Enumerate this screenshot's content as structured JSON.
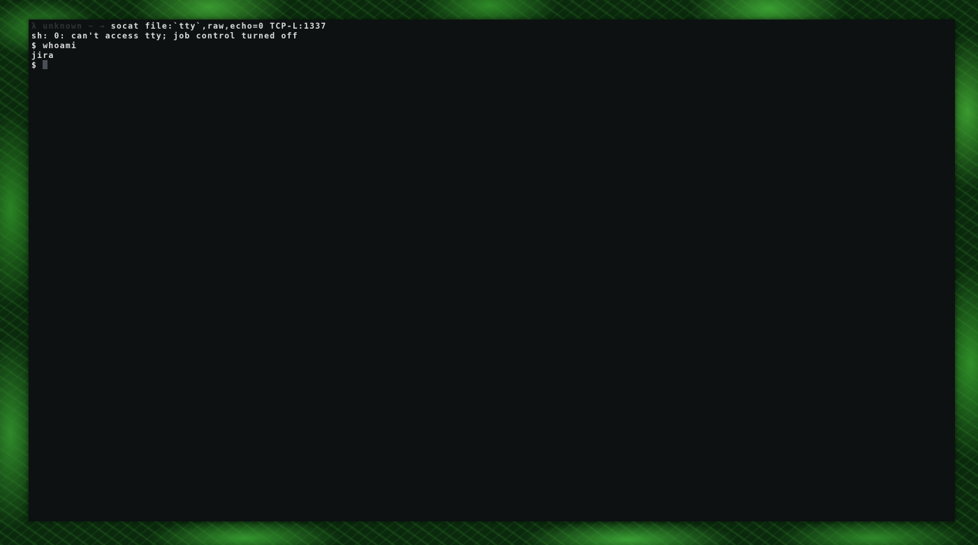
{
  "colors": {
    "terminal_background": "#0d1112",
    "terminal_text": "#dcdcdc",
    "prompt_dim": "#2e3336",
    "cursor": "#4a4f55",
    "wallpaper_dominant": "#2f8a2a"
  },
  "wallpaper": {
    "description_icon": "fern-leaves-wallpaper"
  },
  "terminal": {
    "prompt": {
      "lambda": "λ",
      "host": "unknown",
      "dir": "~",
      "arrow": "→"
    },
    "command": "socat file:`tty`,raw,echo=0 TCP-L:1337",
    "output_line_1": "sh: 0: can't access tty; job control turned off",
    "shell_prompt_1": "$",
    "shell_command_1": "whoami",
    "output_line_2": "jira",
    "shell_prompt_2": "$"
  }
}
